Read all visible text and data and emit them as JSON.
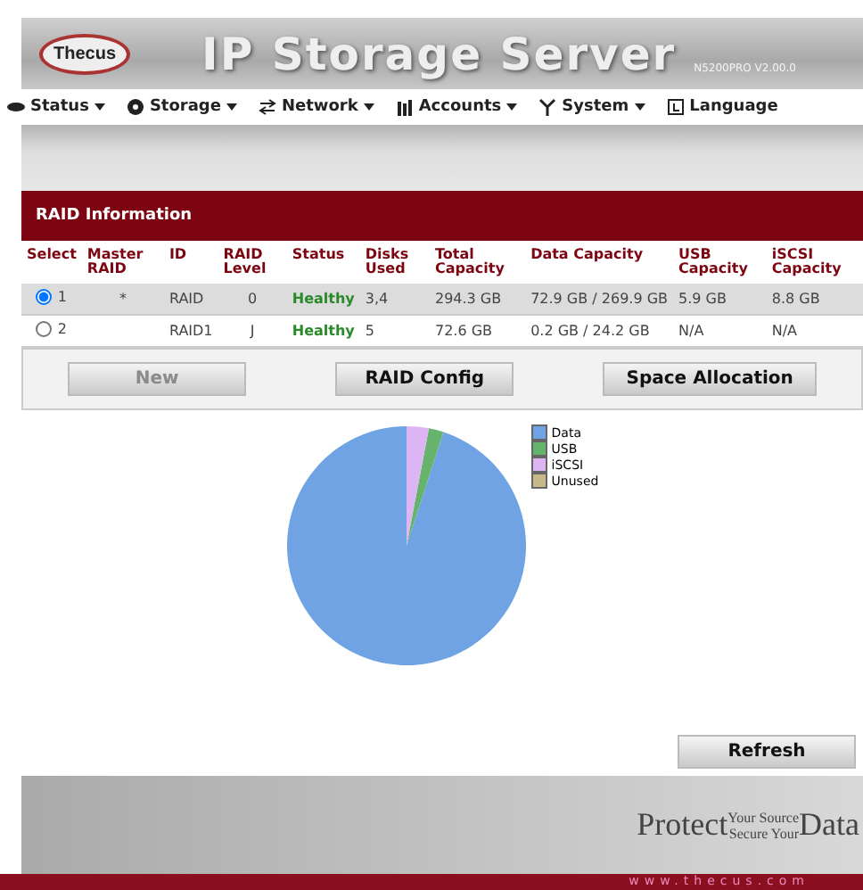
{
  "header": {
    "logo": "Thecus",
    "title": "IP Storage Server",
    "version": "N5200PRO V2.00.0"
  },
  "menu": [
    {
      "label": "Status",
      "dropdown": true
    },
    {
      "label": "Storage",
      "dropdown": true
    },
    {
      "label": "Network",
      "dropdown": true
    },
    {
      "label": "Accounts",
      "dropdown": true
    },
    {
      "label": "System",
      "dropdown": true
    },
    {
      "label": "Language",
      "dropdown": false
    }
  ],
  "panel": {
    "title": "RAID Information",
    "table": {
      "columns": [
        "Select",
        "Master RAID",
        "ID",
        "RAID Level",
        "Status",
        "Disks Used",
        "Total Capacity",
        "Data Capacity",
        "USB Capacity",
        "iSCSI Capacity"
      ],
      "rows": [
        {
          "selected": true,
          "cells": [
            "1",
            "*",
            "RAID",
            "0",
            "Healthy",
            "3,4",
            "294.3 GB",
            "72.9 GB / 269.9 GB",
            "5.9 GB",
            "8.8 GB"
          ]
        },
        {
          "selected": false,
          "cells": [
            "2",
            "",
            "RAID1",
            "J",
            "Healthy",
            "5",
            "72.6 GB",
            "0.2 GB / 24.2 GB",
            "N/A",
            "N/A"
          ]
        }
      ]
    },
    "buttons": [
      {
        "label": "New",
        "disabled": true
      },
      {
        "label": "RAID Config",
        "disabled": false
      },
      {
        "label": "Space Allocation",
        "disabled": false
      }
    ],
    "chart_data": {
      "type": "pie",
      "categories": [
        "Data",
        "USB",
        "iSCSI",
        "Unused"
      ],
      "values": [
        95.0,
        2.0,
        3.0,
        0
      ],
      "legend": "right",
      "colors": [
        "#6fa3e3",
        "#66b36e",
        "#dcb5f2",
        "#c7b98a"
      ]
    },
    "refresh": "Refresh"
  },
  "footer": {
    "slogan_big_1": "Protect",
    "slogan_small_1": "Your Source",
    "slogan_small_2": "Secure Your",
    "slogan_big_2": "Data",
    "url": "www.thecus.com"
  }
}
